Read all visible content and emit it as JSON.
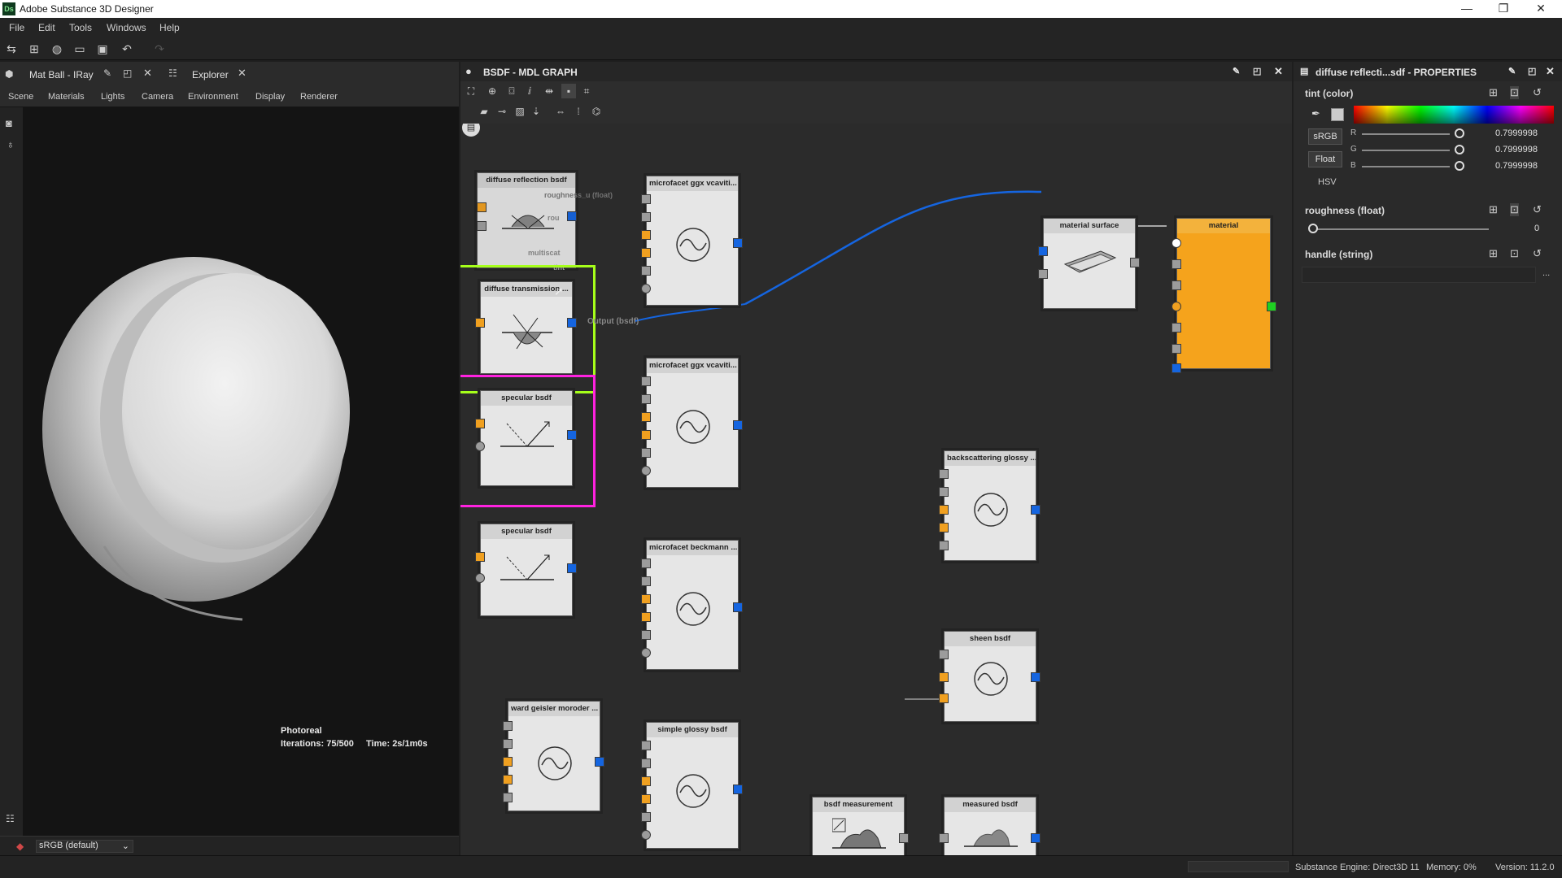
{
  "window": {
    "title": "Adobe Substance 3D Designer",
    "logo": "Ds",
    "minimize": "—",
    "maximize": "❐",
    "close": "✕"
  },
  "menu": [
    "File",
    "Edit",
    "Tools",
    "Windows",
    "Help"
  ],
  "left": {
    "tab1": "Mat Ball - IRay",
    "tab2": "Explorer",
    "subtabs": [
      "Scene",
      "Materials",
      "Lights",
      "Camera",
      "Environment",
      "Display",
      "Renderer"
    ],
    "render_mode": "Photoreal",
    "iterations_label": "Iterations: 75/500",
    "time_label": "Time: 2s/1m0s",
    "colorspace": "sRGB (default)"
  },
  "graph": {
    "title": "BSDF - MDL GRAPH",
    "nodes": {
      "diffuse_reflection": {
        "title": "diffuse reflection bsdf",
        "lbl_roughness": "roughness_u (float)",
        "lbl_rou": "rou",
        "lbl_multiscat": "multiscat",
        "lbl_tint": "tint"
      },
      "diffuse_transmission": {
        "title": "diffuse transmission ...",
        "lbl_output": "Output (bsdf)"
      },
      "specular1": {
        "title": "specular bsdf"
      },
      "specular2": {
        "title": "specular bsdf"
      },
      "ward": {
        "title": "ward geisler moroder ..."
      },
      "ggx1": {
        "title": "microfacet ggx vcaviti..."
      },
      "ggx2": {
        "title": "microfacet ggx vcaviti..."
      },
      "beckmann": {
        "title": "microfacet beckmann ..."
      },
      "simple_glossy": {
        "title": "simple glossy bsdf"
      },
      "backscattering": {
        "title": "backscattering glossy ..."
      },
      "sheen": {
        "title": "sheen bsdf"
      },
      "bsdf_measurement": {
        "title": "bsdf measurement"
      },
      "measured": {
        "title": "measured bsdf"
      },
      "material_surface": {
        "title": "material surface"
      },
      "material": {
        "title": "material"
      }
    }
  },
  "properties": {
    "title": "diffuse reflecti...sdf - PROPERTIES",
    "tint_label": "tint (color)",
    "srgb_btn": "sRGB",
    "float_btn": "Float",
    "hsv_label": "HSV",
    "channels": [
      {
        "name": "R",
        "value": "0.7999998"
      },
      {
        "name": "G",
        "value": "0.7999998"
      },
      {
        "name": "B",
        "value": "0.7999998"
      }
    ],
    "roughness_label": "roughness (float)",
    "roughness_value": "0",
    "handle_label": "handle (string)",
    "handle_value": "",
    "handle_more": "..."
  },
  "status": {
    "engine": "Substance Engine: Direct3D 11",
    "memory": "Memory: 0%",
    "version": "Version: 11.2.0"
  },
  "colors": {
    "accent_orange": "#f0a020",
    "port_blue": "#1565e0",
    "selection_green": "#a6ff1a",
    "selection_magenta": "#ff22e0"
  }
}
